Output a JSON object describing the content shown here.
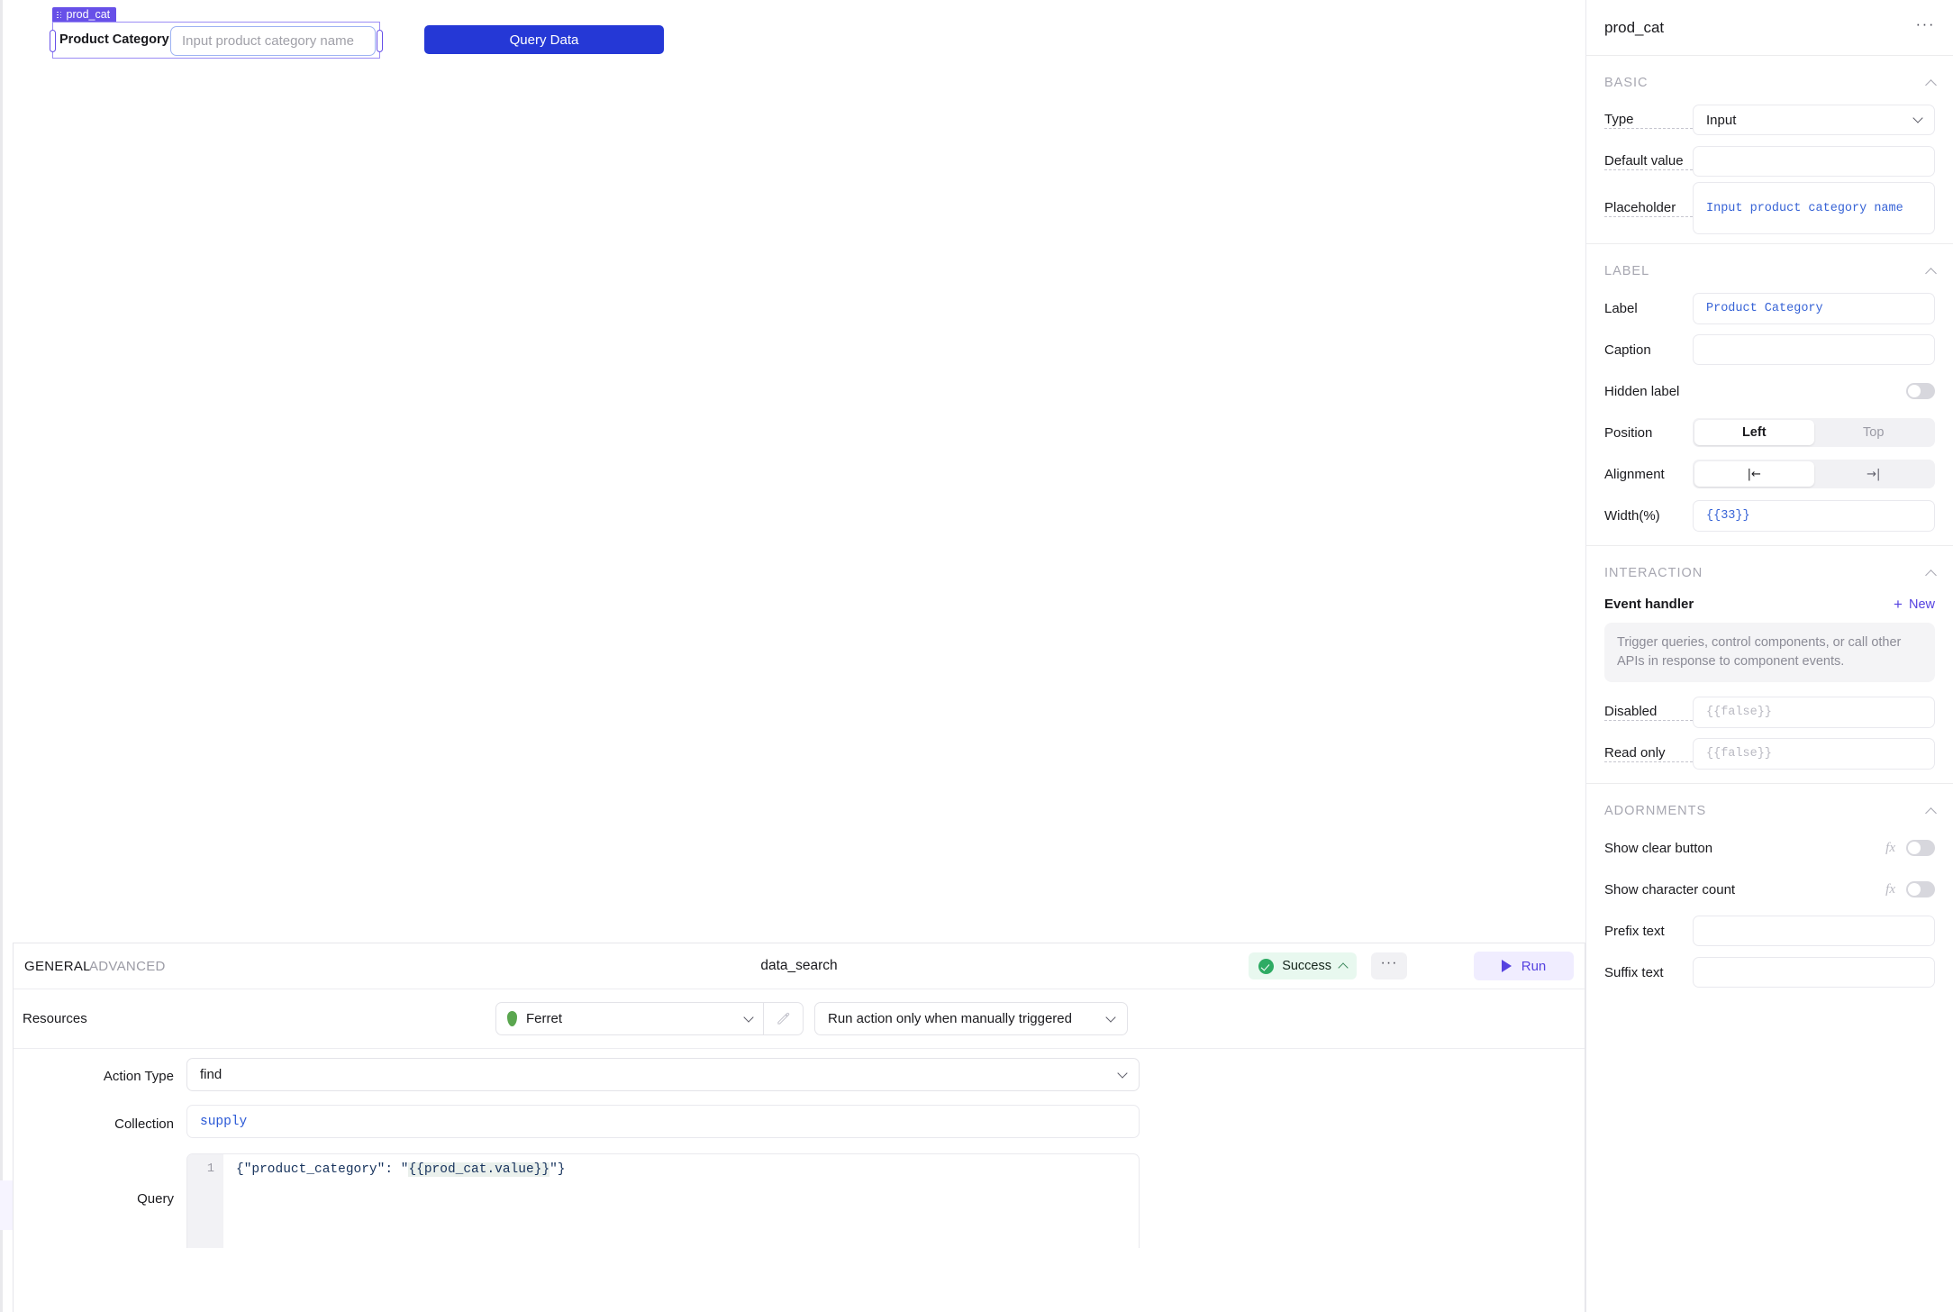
{
  "canvas": {
    "widget": {
      "badge_name": "prod_cat",
      "drag_handle_icon": "drag-grip-icon",
      "label": "Product Category",
      "input_value": "",
      "input_placeholder": "Input product category name"
    },
    "query_button_label": "Query Data"
  },
  "query_panel": {
    "tabs": {
      "general": "GENERAL",
      "advanced": "ADVANCED"
    },
    "title": "data_search",
    "status": {
      "text": "Success",
      "icon": "check-circle-icon",
      "color": "#2eab63",
      "bg": "#e8f8ef"
    },
    "more_label": "···",
    "run_label": "Run",
    "run_icon": "play-icon",
    "rows": {
      "resources_label": "Resources",
      "resource_name": "Ferret",
      "resource_icon": "leaf-icon",
      "edit_icon": "pencil-icon",
      "trigger_text": "Run action only when manually triggered",
      "action_type_label": "Action Type",
      "action_type_value": "find",
      "collection_label": "Collection",
      "collection_value": "supply",
      "query_label": "Query",
      "query_line_number": "1",
      "query_code_prefix": "{\"product_category\": \"",
      "query_code_binding": "{{prod_cat.value}}",
      "query_code_suffix": "\"}"
    }
  },
  "inspector": {
    "title": "prod_cat",
    "more_label": "···",
    "sections": {
      "basic": {
        "title": "BASIC",
        "type_label": "Type",
        "type_value": "Input",
        "default_value_label": "Default value",
        "default_value": "",
        "placeholder_label": "Placeholder",
        "placeholder_value": "Input product category name"
      },
      "label": {
        "title": "LABEL",
        "label_label": "Label",
        "label_value": "Product Category",
        "caption_label": "Caption",
        "caption_value": "",
        "hidden_label_label": "Hidden label",
        "hidden_label_on": false,
        "position_label": "Position",
        "position_options": [
          "Left",
          "Top"
        ],
        "position_selected": "Left",
        "alignment_label": "Alignment",
        "alignment_options": [
          "|←",
          "→|"
        ],
        "alignment_selected": "|←",
        "width_label": "Width(%)",
        "width_value": "{{33}}"
      },
      "interaction": {
        "title": "INTERACTION",
        "event_handler_label": "Event handler",
        "new_label": "New",
        "hint": "Trigger queries, control components, or call other APIs in response to component events.",
        "disabled_label": "Disabled",
        "disabled_value": "{{false}}",
        "readonly_label": "Read only",
        "readonly_value": "{{false}}"
      },
      "adornments": {
        "title": "ADORNMENTS",
        "show_clear_button_label": "Show clear button",
        "show_clear_button_on": false,
        "show_character_count_label": "Show character count",
        "show_character_count_on": false,
        "prefix_text_label": "Prefix text",
        "prefix_text_value": "",
        "suffix_text_label": "Suffix text",
        "suffix_text_value": "",
        "fx_label": "fx"
      }
    }
  }
}
